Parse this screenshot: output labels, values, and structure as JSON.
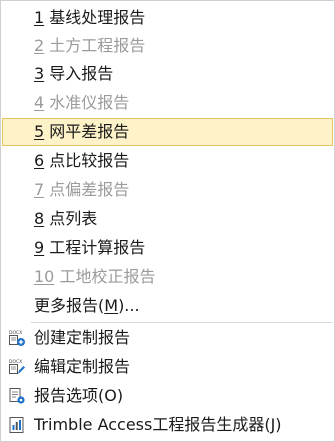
{
  "report_items": [
    {
      "num": "1",
      "text": " 基线处理报告",
      "disabled": false,
      "hover": false
    },
    {
      "num": "2",
      "text": " 土方工程报告",
      "disabled": true,
      "hover": false
    },
    {
      "num": "3",
      "text": " 导入报告",
      "disabled": false,
      "hover": false
    },
    {
      "num": "4",
      "text": " 水准仪报告",
      "disabled": true,
      "hover": false
    },
    {
      "num": "5",
      "text": " 网平差报告",
      "disabled": false,
      "hover": true
    },
    {
      "num": "6",
      "text": " 点比较报告",
      "disabled": false,
      "hover": false
    },
    {
      "num": "7",
      "text": " 点偏差报告",
      "disabled": true,
      "hover": false
    },
    {
      "num": "8",
      "text": " 点列表",
      "disabled": false,
      "hover": false
    },
    {
      "num": "9",
      "text": " 工程计算报告",
      "disabled": false,
      "hover": false
    },
    {
      "num": "10",
      "text": " 工地校正报告",
      "disabled": true,
      "hover": false
    }
  ],
  "more": {
    "pre": "更多报告(",
    "key": "M",
    "post": ")..."
  },
  "actions": {
    "create": "创建定制报告",
    "edit": "编辑定制报告",
    "options": "报告选项(O)",
    "generator": "Trimble  Access工程报告生成器(J)"
  },
  "icons": {
    "create": "docx-add-icon",
    "edit": "docx-edit-icon",
    "options": "report-options-icon",
    "generator": "report-generator-icon"
  },
  "colors": {
    "hover_bg": "#fdf2c8",
    "hover_border": "#e9c75e",
    "disabled_text": "#9b9b9b",
    "accent_blue": "#1e73c8"
  }
}
